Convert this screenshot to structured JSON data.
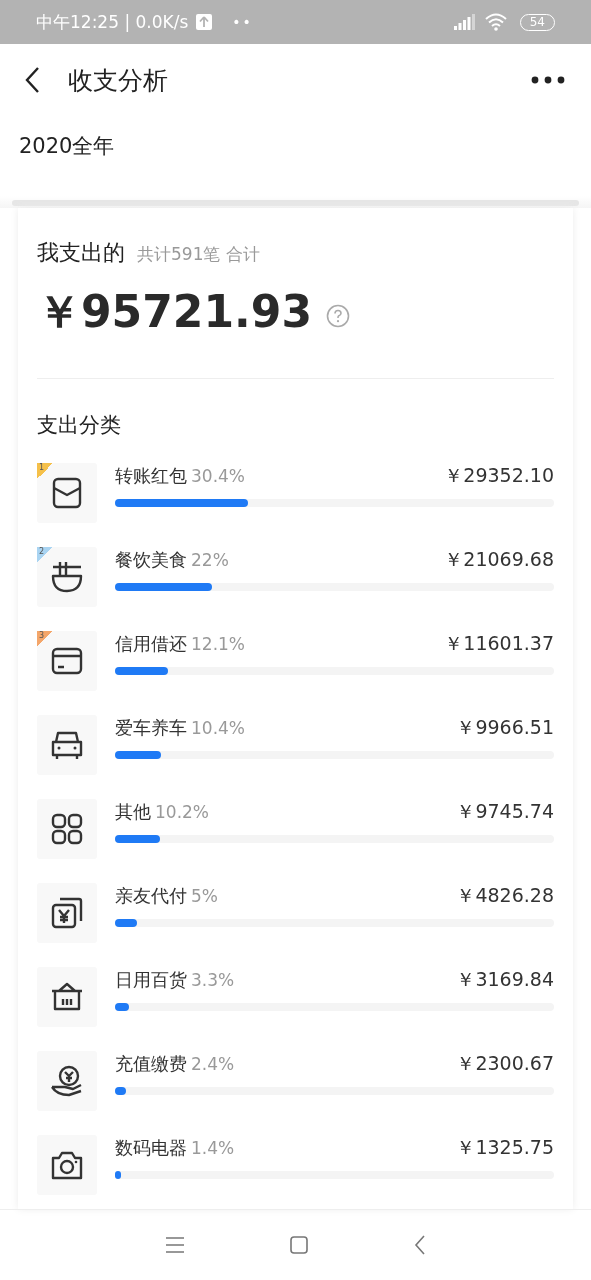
{
  "status_bar": {
    "time_speed": "中午12:25 | 0.0K/s",
    "dots": "••",
    "battery": "54"
  },
  "header": {
    "title": "收支分析"
  },
  "period": "2020全年",
  "summary": {
    "title": "我支出的",
    "count_text": "共计591笔 合计",
    "amount": "￥95721.93"
  },
  "category_section": {
    "title": "支出分类",
    "items": [
      {
        "name": "转账红包",
        "percent": "30.4%",
        "amount": "￥29352.10",
        "level": 0.304,
        "rank": "1",
        "color": "#f5c04a"
      },
      {
        "name": "餐饮美食",
        "percent": "22%",
        "amount": "￥21069.68",
        "level": 0.22,
        "rank": "2",
        "color": "#a9d4f2"
      },
      {
        "name": "信用借还",
        "percent": "12.1%",
        "amount": "￥11601.37",
        "level": 0.121,
        "rank": "3",
        "color": "#f4a66a"
      },
      {
        "name": "爱车养车",
        "percent": "10.4%",
        "amount": "￥9966.51",
        "level": 0.104
      },
      {
        "name": "其他",
        "percent": "10.2%",
        "amount": "￥9745.74",
        "level": 0.102
      },
      {
        "name": "亲友代付",
        "percent": "5%",
        "amount": "￥4826.28",
        "level": 0.05
      },
      {
        "name": "日用百货",
        "percent": "3.3%",
        "amount": "￥3169.84",
        "level": 0.033
      },
      {
        "name": "充值缴费",
        "percent": "2.4%",
        "amount": "￥2300.67",
        "level": 0.024
      },
      {
        "name": "数码电器",
        "percent": "1.4%",
        "amount": "￥1325.75",
        "level": 0.014
      }
    ]
  }
}
